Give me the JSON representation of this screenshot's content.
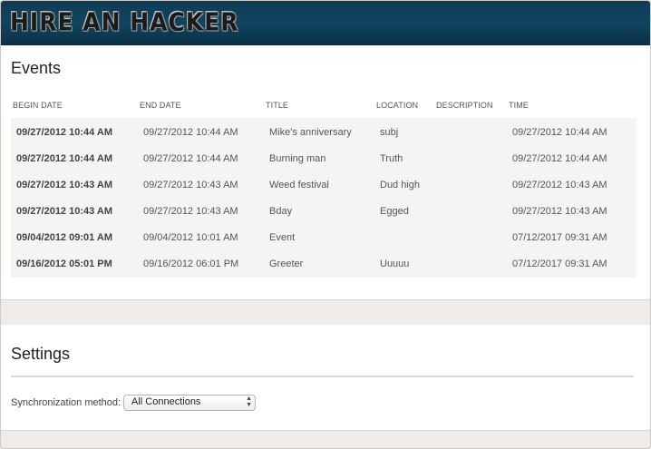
{
  "header": {
    "logo_text": "HIRE AN HACKER"
  },
  "events": {
    "title": "Events",
    "columns": [
      "BEGIN DATE",
      "END DATE",
      "TITLE",
      "LOCATION",
      "DESCRIPTION",
      "TIME"
    ],
    "rows": [
      {
        "begin": "09/27/2012 10:44 AM",
        "end": "09/27/2012 10:44 AM",
        "title": "Mike's anniversary",
        "location": "subj",
        "description": "",
        "time": "09/27/2012 10:44 AM"
      },
      {
        "begin": "09/27/2012 10:44 AM",
        "end": "09/27/2012 10:44 AM",
        "title": "Burning man",
        "location": "Truth",
        "description": "",
        "time": "09/27/2012 10:44 AM"
      },
      {
        "begin": "09/27/2012 10:43 AM",
        "end": "09/27/2012 10:43 AM",
        "title": "Weed festival",
        "location": "Dud high",
        "description": "",
        "time": "09/27/2012 10:43 AM"
      },
      {
        "begin": "09/27/2012 10:43 AM",
        "end": "09/27/2012 10:43 AM",
        "title": "Bday",
        "location": "Egged",
        "description": "",
        "time": "09/27/2012 10:43 AM"
      },
      {
        "begin": "09/04/2012 09:01 AM",
        "end": "09/04/2012 10:01 AM",
        "title": "Event",
        "location": "",
        "description": "",
        "time": "07/12/2017 09:31 AM"
      },
      {
        "begin": "09/16/2012 05:01 PM",
        "end": "09/16/2012 06:01 PM",
        "title": "Greeter",
        "location": "Uuuuu",
        "description": "",
        "time": "07/12/2017 09:31 AM"
      }
    ]
  },
  "settings": {
    "title": "Settings",
    "sync_label": "Synchronization method:",
    "sync_value": "All Connections"
  }
}
